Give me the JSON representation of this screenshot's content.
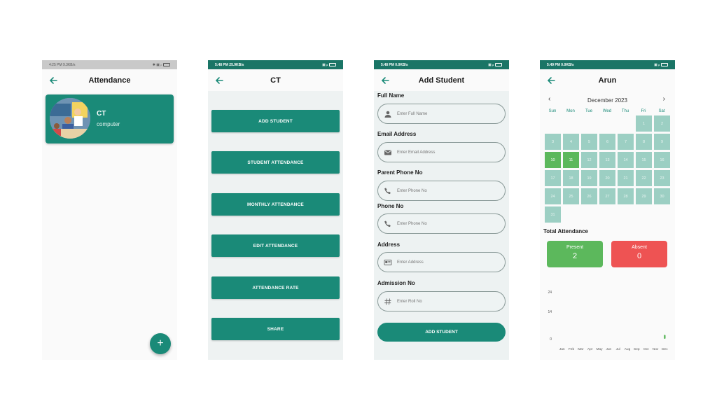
{
  "screen1": {
    "status": {
      "time": "4:25 PM",
      "speed": "9.3KB/s"
    },
    "title": "Attendance",
    "class_card": {
      "name": "CT",
      "subject": "computer"
    },
    "fab_label": "+"
  },
  "screen2": {
    "status": {
      "time": "5:48 PM",
      "speed": "25.9KB/s"
    },
    "title": "CT",
    "buttons": [
      "ADD STUDENT",
      "STUDENT ATTENDANCE",
      "MONTHLY ATTENDANCE",
      "EDIT ATTENDANCE",
      "ATTENDANCE RATE",
      "SHARE"
    ]
  },
  "screen3": {
    "status": {
      "time": "5:48 PM",
      "speed": "0.0KB/s"
    },
    "title": "Add Student",
    "fields": [
      {
        "label": "Full Name",
        "placeholder": "Enter Full Name",
        "icon": "person-icon"
      },
      {
        "label": "Email Address",
        "placeholder": "Enter Email Address",
        "icon": "mail-icon"
      },
      {
        "label": "Parent Phone No",
        "placeholder": "Enter Phone No",
        "icon": "phone-icon"
      },
      {
        "label": "Phone No",
        "placeholder": "Enter Phone No",
        "icon": "phone-icon"
      },
      {
        "label": "Address",
        "placeholder": "Enter Address",
        "icon": "address-card-icon"
      },
      {
        "label": "Admission No",
        "placeholder": "Enter Roll No",
        "icon": "hash-icon"
      }
    ],
    "submit_label": "ADD STUDENT"
  },
  "screen4": {
    "status": {
      "time": "5:49 PM",
      "speed": "0.0KB/s"
    },
    "title": "Arun",
    "calendar": {
      "month_label": "December 2023",
      "weekdays": [
        "Sun",
        "Mon",
        "Tue",
        "Wed",
        "Thu",
        "Fri",
        "Sat"
      ],
      "first_weekday": 5,
      "days_in_month": 31,
      "present_days": [
        10,
        11
      ]
    },
    "total_title": "Total Attendance",
    "present": {
      "label": "Present",
      "value": "2"
    },
    "absent": {
      "label": "Absent",
      "value": "0"
    },
    "chart_data": {
      "type": "bar",
      "categories": [
        "Jan",
        "Feb",
        "Mar",
        "Apr",
        "May",
        "Jun",
        "Jul",
        "Aug",
        "Sep",
        "Oct",
        "Nov",
        "Dec"
      ],
      "values": [
        0,
        0,
        0,
        0,
        0,
        0,
        0,
        0,
        0,
        0,
        0,
        2
      ],
      "y_ticks": [
        "24",
        "14",
        "0"
      ],
      "ylim": [
        0,
        28
      ],
      "colors": {
        "bar": "#5cb85c"
      }
    }
  },
  "colors": {
    "primary": "#1a8a78",
    "statusbar": "#1a7566",
    "present": "#5cb85c",
    "absent": "#ee5353"
  }
}
